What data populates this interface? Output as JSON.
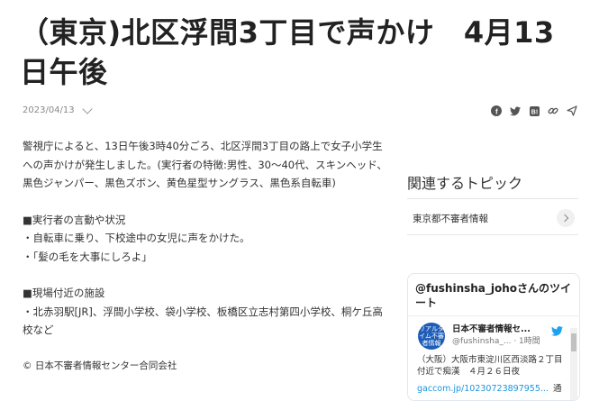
{
  "article": {
    "title": "（東京)北区浮間3丁目で声かけ　4月13日午後",
    "date": "2023/04/13",
    "paragraphs": [
      "警視庁によると、13日午後3時40分ごろ、北区浮間3丁目の路上で女子小学生への声かけが発生しました。(実行者の特徴:男性、30～40代、スキンヘッド、黒色ジャンパー、黒色ズボン、黄色星型サングラス、黒色系自転車)",
      "■実行者の言動や状況\n・自転車に乗り、下校途中の女児に声をかけた。\n・「髪の毛を大事にしろよ」",
      "■現場付近の施設\n・北赤羽駅[JR]、浮間小学校、袋小学校、板橋区立志村第四小学校、桐ケ丘高校など"
    ],
    "copyright": "© 日本不審者情報センター合同会社"
  },
  "share_icons": [
    "facebook-icon",
    "twitter-icon",
    "hatena-icon",
    "link-icon",
    "send-icon"
  ],
  "sidebar": {
    "heading": "関連するトピック",
    "topics": [
      {
        "label": "東京都不審者情報"
      }
    ]
  },
  "twitter_widget": {
    "title": "@fushinsha_johoさんのツイート",
    "avatar_text": "リアルタイム不審者情報",
    "name": "日本不審者情報セ...",
    "handle": "@fushinsha_... · 1時間",
    "text": "（大阪）大阪市東淀川区西淡路２丁目付近で痴漢　４月２６日夜",
    "link": "gaccom.jp/10230723897955...",
    "trailing": "通話"
  },
  "colors": {
    "accent": "#1da1f2",
    "text": "#333333"
  }
}
